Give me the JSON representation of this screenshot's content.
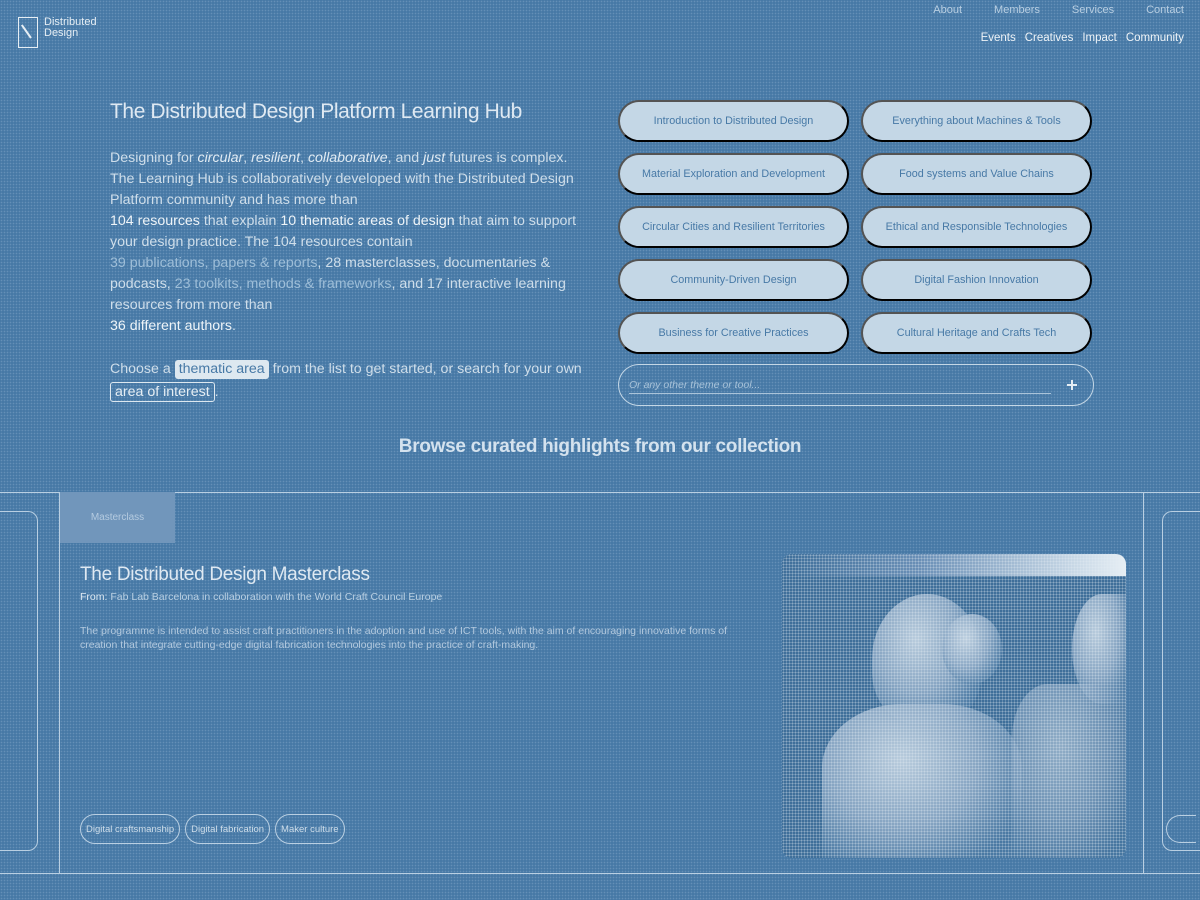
{
  "brand": {
    "line1": "Distributed",
    "line2": "Design"
  },
  "nav": {
    "top": [
      "About",
      "Members",
      "Services",
      "Contact"
    ],
    "main": [
      "Events",
      "Creatives",
      "Impact",
      "Community"
    ]
  },
  "hero": {
    "title": "The Distributed Design Platform Learning Hub",
    "intro": {
      "p1": "Designing for ",
      "w_circular": "circular",
      "c1": ", ",
      "w_resilient": "resilient",
      "c2": ", ",
      "w_collaborative": "collaborative",
      "c3": ", and ",
      "w_just": "just",
      "p2": " futures is complex. The Learning Hub is collaboratively developed with the Distributed Design Platform community and has more than",
      "resources_count": "104 resources",
      "p3": " that explain ",
      "areas_count": "10 thematic areas of design",
      "p4": " that aim to support your design practice. The 104 resources contain",
      "publications": "39 publications, papers & reports",
      "c4": ", ",
      "masterclasses": "28 masterclasses, documentaries & podcasts",
      "c5": ", ",
      "toolkits": "23 toolkits, methods & frameworks",
      "p5": ", and ",
      "interactive": "17 interactive learning resources",
      "p6": " from more than",
      "authors": "36 different authors",
      "p7": "."
    },
    "choose": {
      "p1": "Choose a ",
      "chip1": "thematic area",
      "p2": " from the list to get started, or search for your own ",
      "chip2": "area of interest",
      "p3": "."
    }
  },
  "themes": [
    "Introduction to Distributed Design",
    "Everything about Machines & Tools",
    "Material Exploration and Development",
    "Food systems and Value Chains",
    "Circular Cities and Resilient Territories",
    "Ethical and Responsible Technologies",
    "Community-Driven Design",
    "Digital Fashion Innovation",
    "Business for Creative Practices",
    "Cultural Heritage and Crafts Tech"
  ],
  "search": {
    "placeholder": "Or any other theme or tool..."
  },
  "browse_title": "Browse curated highlights from our collection",
  "card": {
    "tab": "Masterclass",
    "title": "The Distributed Design Masterclass",
    "from_label": "From:",
    "from": "Fab Lab Barcelona in collaboration with the World Craft Council Europe",
    "description": "The programme is intended to assist craft practitioners in the adoption and use of ICT tools, with the aim of encouraging innovative forms of creation that integrate cutting-edge digital fabrication technologies into the practice of craft-making.",
    "tags": [
      "Digital craftsmanship",
      "Digital fabrication",
      "Maker culture"
    ]
  }
}
